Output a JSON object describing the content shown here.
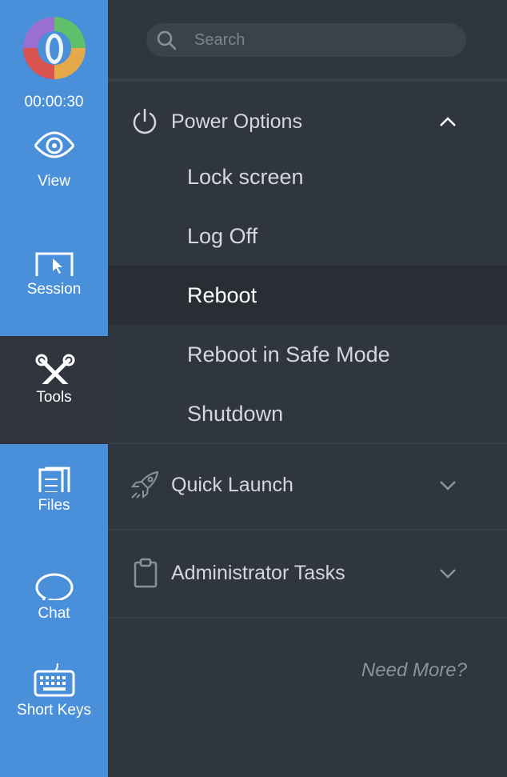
{
  "sidebar": {
    "timer": "00:00:30",
    "items": [
      {
        "label": "View",
        "icon": "eye-icon"
      },
      {
        "label": "Session",
        "icon": "monitor-cursor-icon"
      },
      {
        "label": "Tools",
        "icon": "tools-icon",
        "active": true
      },
      {
        "label": "Files",
        "icon": "files-icon"
      },
      {
        "label": "Chat",
        "icon": "chat-bubble-icon"
      },
      {
        "label": "Short Keys",
        "icon": "keyboard-icon"
      }
    ]
  },
  "search": {
    "placeholder": "Search"
  },
  "sections": {
    "power": {
      "title": "Power Options",
      "icon": "power-icon",
      "expanded": true,
      "items": [
        "Lock screen",
        "Log Off",
        "Reboot",
        "Reboot in Safe Mode",
        "Shutdown"
      ],
      "selected": "Reboot"
    },
    "quick_launch": {
      "title": "Quick Launch",
      "icon": "rocket-icon",
      "expanded": false
    },
    "admin": {
      "title": "Administrator Tasks",
      "icon": "clipboard-icon",
      "expanded": false
    }
  },
  "footer": {
    "need_more": "Need More?"
  },
  "colors": {
    "sidebar": "#4a8fd9",
    "panel": "#303640",
    "active_nav": "#2f343d",
    "selected_item": "#292d34"
  }
}
